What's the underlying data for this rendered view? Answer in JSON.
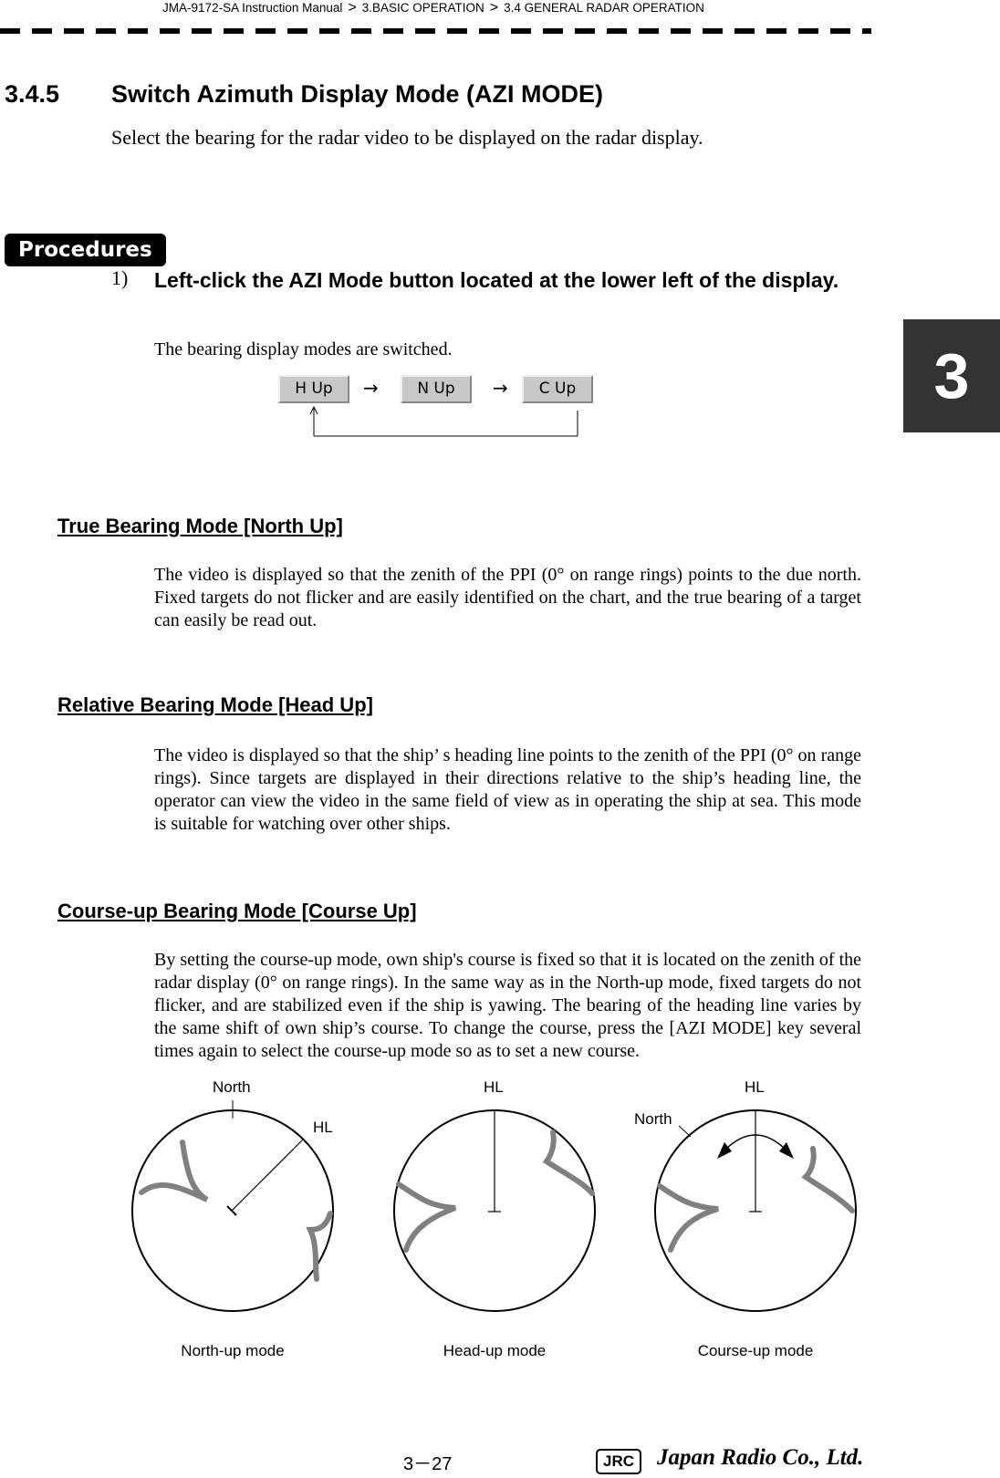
{
  "header": {
    "breadcrumb": [
      "JMA-9172-SA Instruction Manual",
      "3.BASIC OPERATION",
      "3.4  GENERAL RADAR OPERATION"
    ],
    "separator": ">"
  },
  "chapter_tab": "3",
  "section": {
    "number": "3.4.5",
    "title": "Switch Azimuth Display Mode (AZI MODE)",
    "intro": "Select the bearing for the radar video to be displayed on the radar display."
  },
  "procedures": {
    "badge": "Procedures",
    "steps": [
      {
        "number": "1)",
        "text": "Left-click the  AZI Mode  button located at the lower left of the display.",
        "result": "The bearing display modes are switched."
      }
    ],
    "mode_cycle": {
      "buttons": [
        "H Up",
        "N Up",
        "C Up"
      ],
      "arrow": "→",
      "return_arrow": "↑"
    }
  },
  "modes": [
    {
      "heading": "True Bearing Mode [North Up]",
      "text": "The video is displayed so that the zenith of the PPI (0° on range rings) points to the due north. Fixed targets do not flicker and are easily identified on the chart, and the true bearing of a target can easily be read out."
    },
    {
      "heading": "Relative Bearing Mode [Head Up]",
      "text": "The video is displayed so that the ship’ s heading line points to the zenith of the PPI (0° on range rings). Since targets are displayed in their directions relative to the ship’s heading line, the operator can view the video in the same field of view as in operating the ship at sea. This mode is suitable for watching over other ships."
    },
    {
      "heading": "Course-up Bearing Mode [Course Up]",
      "text": "By setting the course-up mode, own ship's course is fixed so that it is located on the zenith of the radar display (0°  on range rings). In the same way as in the North-up mode, fixed targets do not flicker, and are stabilized even if the ship is yawing. The bearing of the heading line varies by the same shift of own ship’s course. To change the course, press the [AZI MODE] key several times again to select the course-up mode so as to set a new course."
    }
  ],
  "figures": {
    "north_up": {
      "caption": "North-up mode",
      "labels": {
        "north": "North",
        "hl": "HL"
      }
    },
    "head_up": {
      "caption": "Head-up mode",
      "labels": {
        "hl": "HL"
      }
    },
    "course_up": {
      "caption": "Course-up mode",
      "labels": {
        "north": "North",
        "hl": "HL"
      }
    }
  },
  "footer": {
    "page_number": "3－27",
    "logo": "JRC",
    "company": "Japan Radio Co., Ltd."
  }
}
